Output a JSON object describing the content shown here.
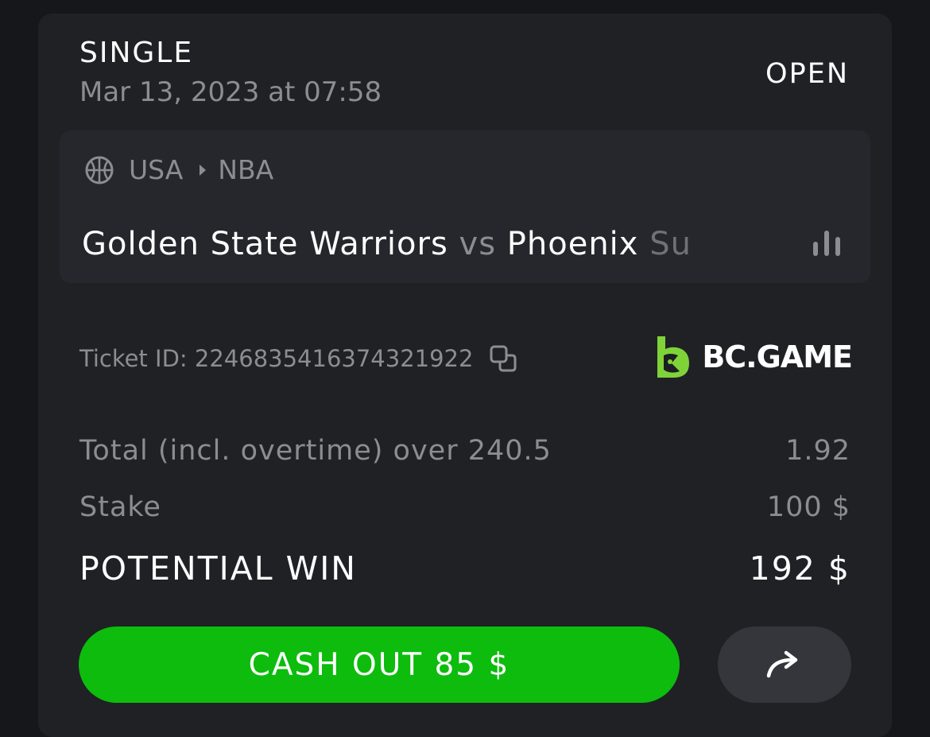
{
  "bet": {
    "type": "SINGLE",
    "date": "Mar 13, 2023 at 07:58",
    "status": "OPEN"
  },
  "event": {
    "sport_icon": "basketball-icon",
    "country": "USA",
    "league": "NBA",
    "home_team": "Golden State Warriors",
    "vs": "vs",
    "away_team_visible": "Phoenix",
    "away_team_cut": "Su",
    "stats_icon": "stats-bars-icon"
  },
  "ticket": {
    "label": "Ticket ID: 2246835416374321922",
    "copy_icon": "copy-icon"
  },
  "brand": {
    "name": "BC.GAME",
    "color": "#7fd339"
  },
  "lines": {
    "market_label": "Total (incl. overtime) over 240.5",
    "odds": "1.92",
    "stake_label": "Stake",
    "stake_value": "100 $",
    "win_label": "POTENTIAL WIN",
    "win_value": "192 $"
  },
  "actions": {
    "cashout_label": "CASH OUT 85 $",
    "cashout_color": "#0dbc0d",
    "share_icon": "share-arrow-icon"
  }
}
